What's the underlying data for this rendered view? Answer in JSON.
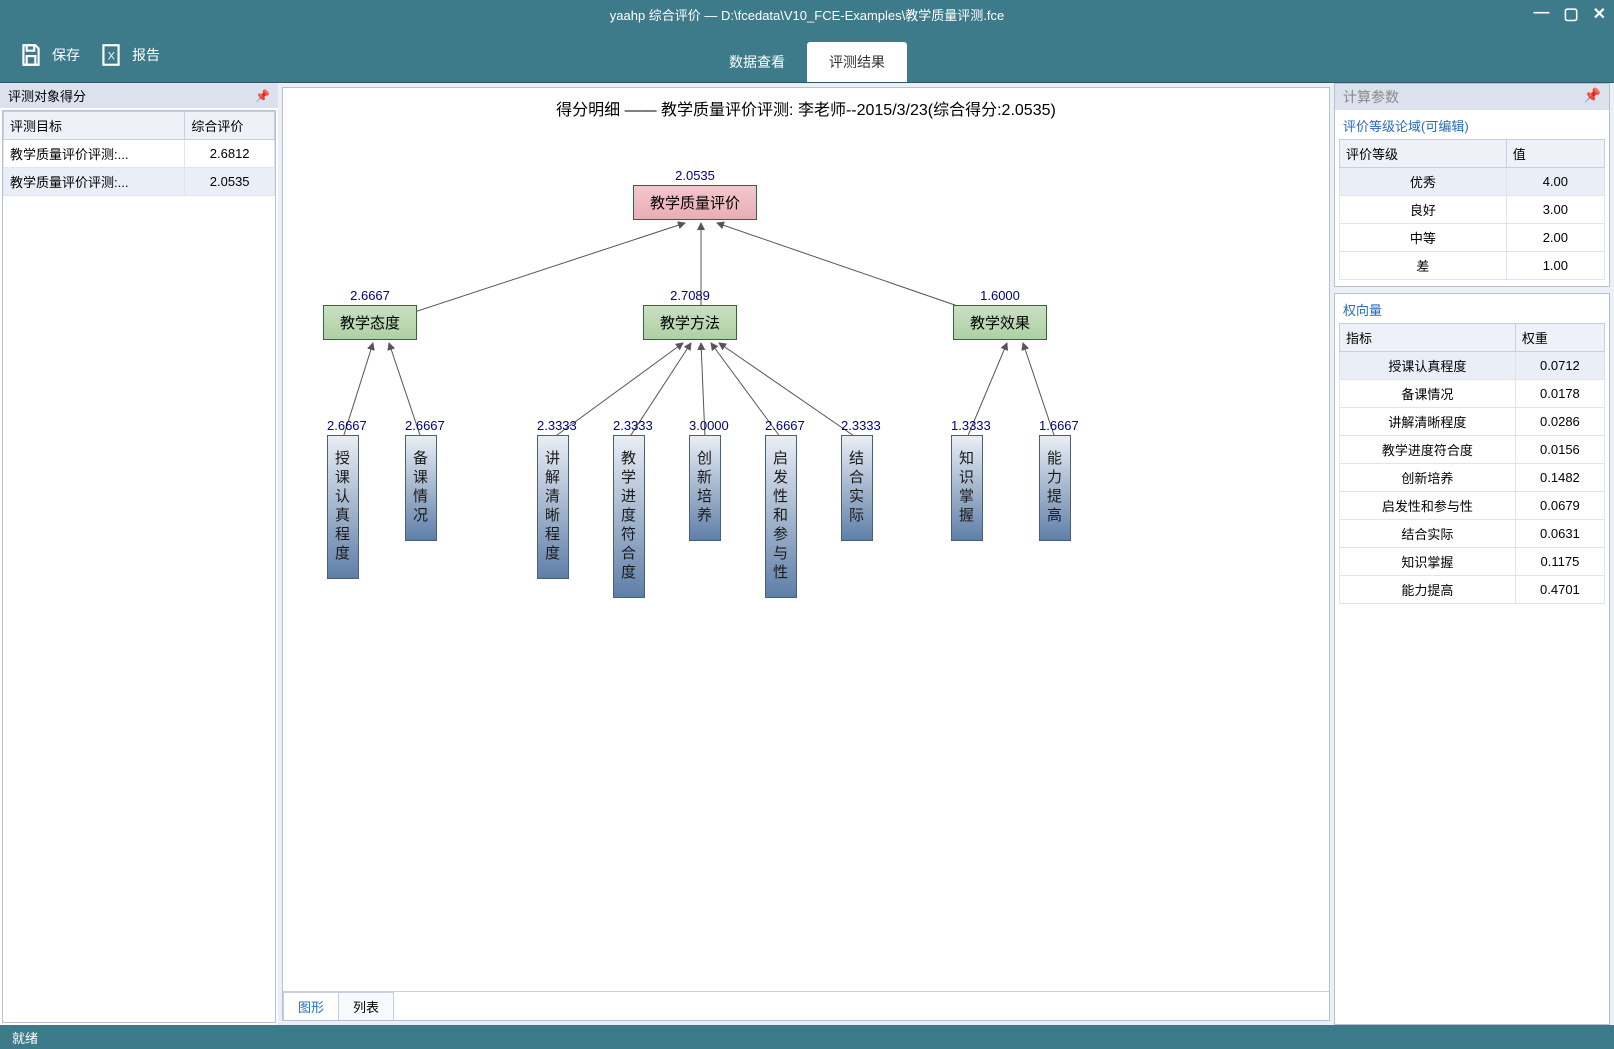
{
  "titlebar": {
    "title": "yaahp 综合评价  — D:\\fcedata\\V10_FCE-Examples\\教学质量评测.fce"
  },
  "toolbar": {
    "save": "保存",
    "report": "报告"
  },
  "tabs": {
    "view": "数据查看",
    "result": "评测结果"
  },
  "left": {
    "header": "评测对象得分",
    "col1": "评测目标",
    "col2": "综合评价",
    "rows": [
      {
        "a": "教学质量评价评测:...",
        "b": "2.6812"
      },
      {
        "a": "教学质量评价评测:...",
        "b": "2.0535"
      }
    ]
  },
  "chart": {
    "title": "得分明细 —— 教学质量评价评测: 李老师--2015/3/23(综合得分:2.0535)",
    "root": {
      "score": "2.0535",
      "label": "教学质量评价"
    },
    "mids": [
      {
        "score": "2.6667",
        "label": "教学态度"
      },
      {
        "score": "2.7089",
        "label": "教学方法"
      },
      {
        "score": "1.6000",
        "label": "教学效果"
      }
    ],
    "leaves": [
      {
        "score": "2.6667",
        "label": "授课认真程度"
      },
      {
        "score": "2.6667",
        "label": "备课情况"
      },
      {
        "score": "2.3333",
        "label": "讲解清晰程度"
      },
      {
        "score": "2.3333",
        "label": "教学进度符合度"
      },
      {
        "score": "3.0000",
        "label": "创新培养"
      },
      {
        "score": "2.6667",
        "label": "启发性和参与性"
      },
      {
        "score": "2.3333",
        "label": "结合实际"
      },
      {
        "score": "1.3333",
        "label": "知识掌握"
      },
      {
        "score": "1.6667",
        "label": "能力提高"
      }
    ]
  },
  "bottom_tabs": {
    "graph": "图形",
    "list": "列表"
  },
  "right": {
    "header": "计算参数",
    "levels_title": "评价等级论域(可编辑)",
    "level_col1": "评价等级",
    "level_col2": "值",
    "levels": [
      {
        "a": "优秀",
        "b": "4.00"
      },
      {
        "a": "良好",
        "b": "3.00"
      },
      {
        "a": "中等",
        "b": "2.00"
      },
      {
        "a": "差",
        "b": "1.00"
      }
    ],
    "weights_title": "权向量",
    "weight_col1": "指标",
    "weight_col2": "权重",
    "weights": [
      {
        "a": "授课认真程度",
        "b": "0.0712"
      },
      {
        "a": "备课情况",
        "b": "0.0178"
      },
      {
        "a": "讲解清晰程度",
        "b": "0.0286"
      },
      {
        "a": "教学进度符合度",
        "b": "0.0156"
      },
      {
        "a": "创新培养",
        "b": "0.1482"
      },
      {
        "a": "启发性和参与性",
        "b": "0.0679"
      },
      {
        "a": "结合实际",
        "b": "0.0631"
      },
      {
        "a": "知识掌握",
        "b": "0.1175"
      },
      {
        "a": "能力提高",
        "b": "0.4701"
      }
    ]
  },
  "status": "就绪",
  "chart_data": {
    "type": "tree",
    "title": "得分明细 —— 教学质量评价评测: 李老师--2015/3/23(综合得分:2.0535)",
    "root": {
      "name": "教学质量评价",
      "value": 2.0535
    },
    "children": [
      {
        "name": "教学态度",
        "value": 2.6667,
        "children": [
          {
            "name": "授课认真程度",
            "value": 2.6667
          },
          {
            "name": "备课情况",
            "value": 2.6667
          }
        ]
      },
      {
        "name": "教学方法",
        "value": 2.7089,
        "children": [
          {
            "name": "讲解清晰程度",
            "value": 2.3333
          },
          {
            "name": "教学进度符合度",
            "value": 2.3333
          },
          {
            "name": "创新培养",
            "value": 3.0
          },
          {
            "name": "启发性和参与性",
            "value": 2.6667
          },
          {
            "name": "结合实际",
            "value": 2.3333
          }
        ]
      },
      {
        "name": "教学效果",
        "value": 1.6,
        "children": [
          {
            "name": "知识掌握",
            "value": 1.3333
          },
          {
            "name": "能力提高",
            "value": 1.6667
          }
        ]
      }
    ]
  }
}
